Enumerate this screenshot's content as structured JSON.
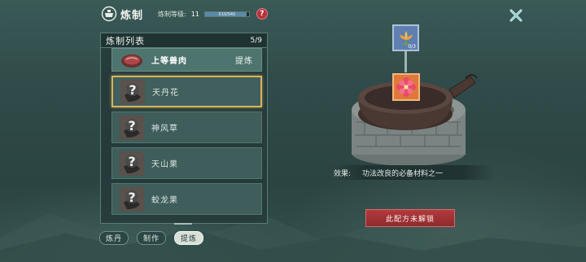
{
  "header": {
    "title": "炼制",
    "level_label": "炼制等级:",
    "level_value": "11",
    "xp_text": "510/540",
    "xp_progress": 0.944,
    "help_label": "?"
  },
  "list": {
    "title": "炼制列表",
    "count": "5/9",
    "items": [
      {
        "name": "上等兽肉",
        "action": "提炼",
        "icon": "meat-icon"
      },
      {
        "name": "天丹花",
        "icon": "locked-question-icon"
      },
      {
        "name": "神风草",
        "icon": "locked-question-icon"
      },
      {
        "name": "天山果",
        "icon": "locked-question-icon"
      },
      {
        "name": "蛟龙果",
        "icon": "locked-question-icon"
      }
    ]
  },
  "tabs": [
    {
      "label": "炼丹"
    },
    {
      "label": "制作"
    },
    {
      "label": "提炼",
      "active": true
    }
  ],
  "recipe": {
    "ingredient_icon": "lotus-flower-icon",
    "ingredient_count": "0/3",
    "result_icon": "red-flower-icon",
    "effect_label": "效果:",
    "effect_text": "功法改良的必备材料之一",
    "unlock_button": "此配方未解锁"
  },
  "colors": {
    "accent_gold": "#d9b35c",
    "button_red": "#b23a3d",
    "panel_teal": "#3e5d5b"
  }
}
